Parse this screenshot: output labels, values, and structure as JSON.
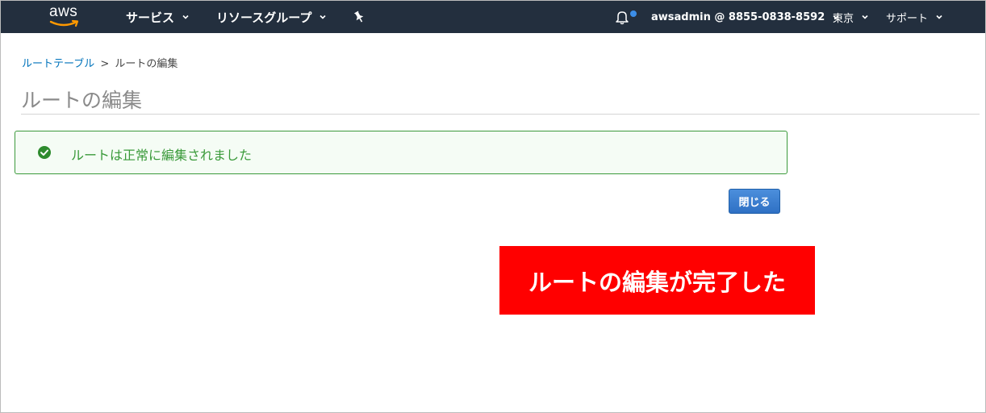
{
  "navbar": {
    "logo_text": "aws",
    "services_label": "サービス",
    "resource_groups_label": "リソースグループ",
    "account_label": "awsadmin @ 8855-0838-8592",
    "region_label": "東京",
    "support_label": "サポート",
    "background_color": "#232f3e",
    "notification_dot_color": "#3c8ee8",
    "icons": [
      "caret-down-icon",
      "pin-icon",
      "bell-icon"
    ]
  },
  "breadcrumb": {
    "parent_label": "ルートテーブル",
    "separator": ">",
    "current_label": "ルートの編集"
  },
  "page": {
    "title": "ルートの編集"
  },
  "alert": {
    "type": "success",
    "icon": "check-circle-icon",
    "message": "ルートは正常に編集されました",
    "color": "#3a9a3a"
  },
  "actions": {
    "close_label": "閉じる",
    "button_color": "#2f70c4"
  },
  "annotation": {
    "text": "ルートの編集が完了した",
    "color": "#ff0000"
  }
}
